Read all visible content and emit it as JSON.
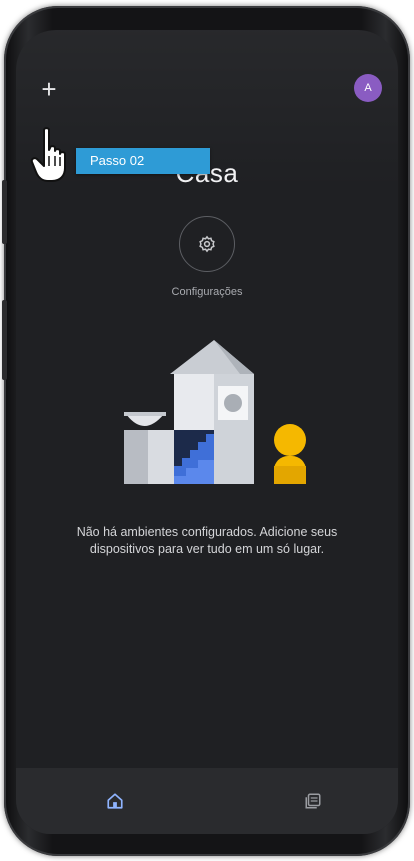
{
  "header": {
    "add_glyph": "+",
    "avatar_initial": "A",
    "title": "Casa"
  },
  "settings": {
    "label": "Configurações"
  },
  "empty_state": {
    "message": "Não há ambientes configurados. Adicione seus dispositivos para ver tudo em um só lugar."
  },
  "tutorial": {
    "step_label": "Passo 02"
  },
  "bottom_nav": {
    "items": [
      {
        "icon": "home-icon",
        "active": true
      },
      {
        "icon": "feed-icon",
        "active": false
      }
    ]
  },
  "colors": {
    "screen_bg": "#1f2023",
    "avatar": "#8a5cc2",
    "step_tag": "#2e9bd6",
    "nav_active": "#8fb4ff",
    "nav_inactive": "#9a9ca1"
  }
}
